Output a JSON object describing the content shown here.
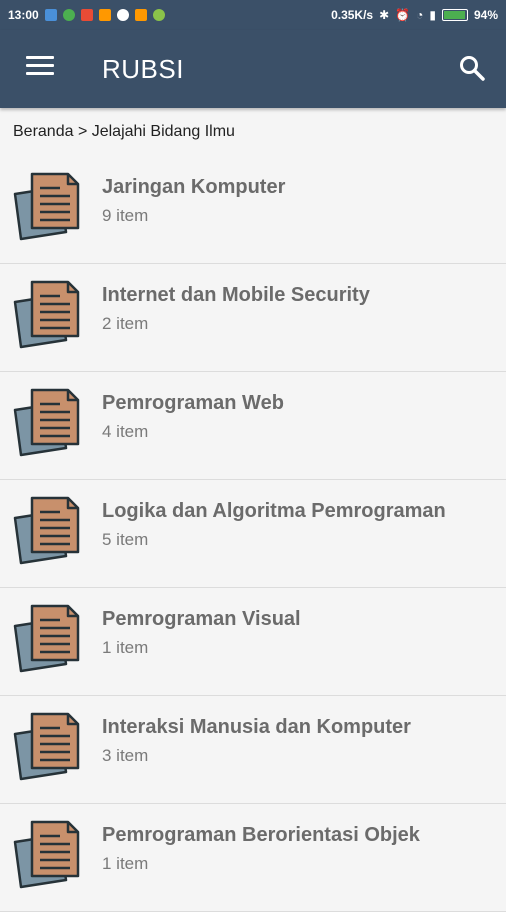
{
  "status_bar": {
    "time": "13:00",
    "speed": "0.35K/s",
    "battery": "94%",
    "battery_level": 0.94
  },
  "app_bar": {
    "title": "RUBSI"
  },
  "breadcrumb": "Beranda > Jelajahi Bidang Ilmu",
  "items": [
    {
      "title": "Jaringan Komputer",
      "count": "9 item"
    },
    {
      "title": "Internet dan Mobile Security",
      "count": "2 item"
    },
    {
      "title": "Pemrograman Web",
      "count": "4 item"
    },
    {
      "title": "Logika dan Algoritma Pemrograman",
      "count": "5 item"
    },
    {
      "title": "Pemrograman Visual",
      "count": "1 item"
    },
    {
      "title": "Interaksi Manusia dan Komputer",
      "count": "3 item"
    },
    {
      "title": "Pemrograman Berorientasi Objek",
      "count": "1 item"
    }
  ],
  "colors": {
    "app_bar": "#3b5068",
    "doc_front": "#c8906c",
    "doc_back": "#7c95a5"
  }
}
